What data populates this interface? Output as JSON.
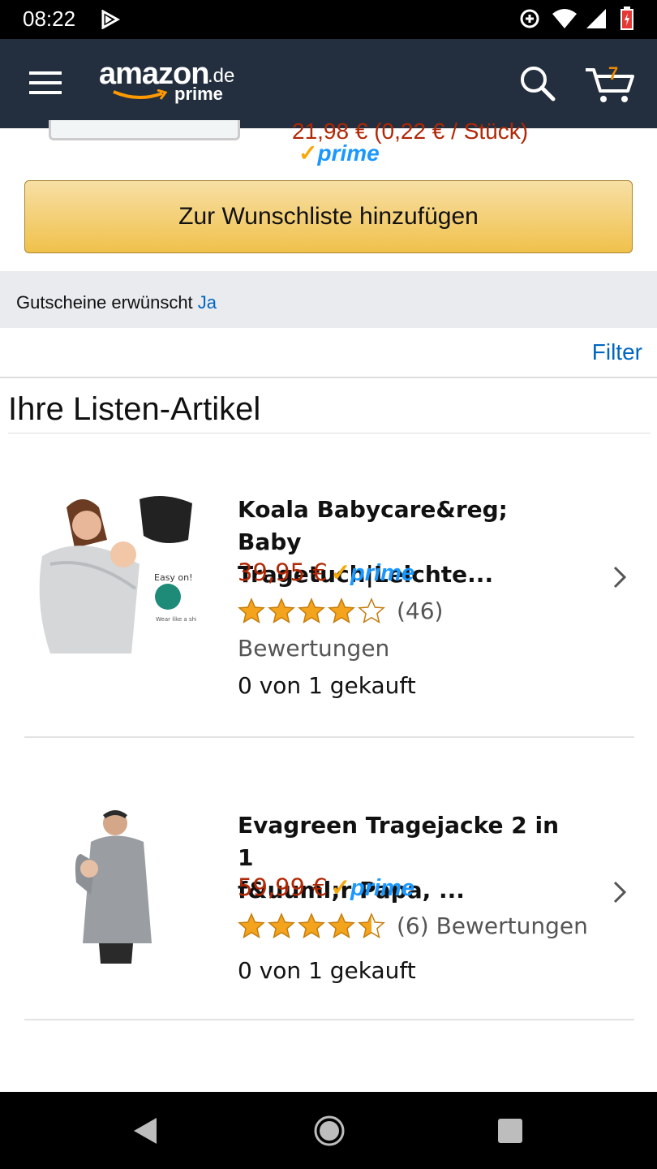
{
  "status_bar": {
    "time": "08:22",
    "icons": [
      "play-store-notification-icon",
      "data-saver-icon",
      "wifi-icon",
      "signal-icon",
      "battery-charging-icon"
    ]
  },
  "header": {
    "logo_text": "amazon",
    "logo_domain": ".de",
    "logo_sub": "prime",
    "cart_count": "7",
    "icons": [
      "menu-icon",
      "search-icon",
      "cart-icon"
    ]
  },
  "top_card": {
    "partial_price": "21,98 € (0,22 € / Stück)",
    "prime_label": "prime",
    "wishlist_button": "Zur Wunschliste hinzufügen"
  },
  "coupon": {
    "label": "Gutscheine erwünscht",
    "value": "Ja"
  },
  "filter_label": "Filter",
  "section_title": "Ihre Listen-Artikel",
  "items": [
    {
      "title_line1": "Koala Babycare&reg; Baby",
      "title_line2": "Tragetuch|Leichte...",
      "price": "39,95 €",
      "prime": "prime",
      "rating": 4.0,
      "reviews": "(46)",
      "reviews_suffix": "Bewertungen",
      "purchased": "0 von 1 gekauft",
      "thumb_caption": "Easy on!",
      "thumb_subcaption": "Wear like a shirt"
    },
    {
      "title_line1": "Evagreen Tragejacke 2 in 1",
      "title_line2": "f&uuml;r Papa, ...",
      "price": "59,99 €",
      "prime": "prime",
      "rating": 4.5,
      "reviews": "(6) Bewertungen",
      "purchased": "0 von 1 gekauft"
    }
  ],
  "colors": {
    "header_bg": "#232f3e",
    "price": "#b12704",
    "link": "#0066c0",
    "prime_blue": "#1a98ff",
    "prime_check": "#f7a90a",
    "star": "#f4a41c",
    "button": "#f0c14b"
  },
  "nav_bar": {
    "icons": [
      "back-icon",
      "home-icon",
      "recents-icon"
    ]
  }
}
